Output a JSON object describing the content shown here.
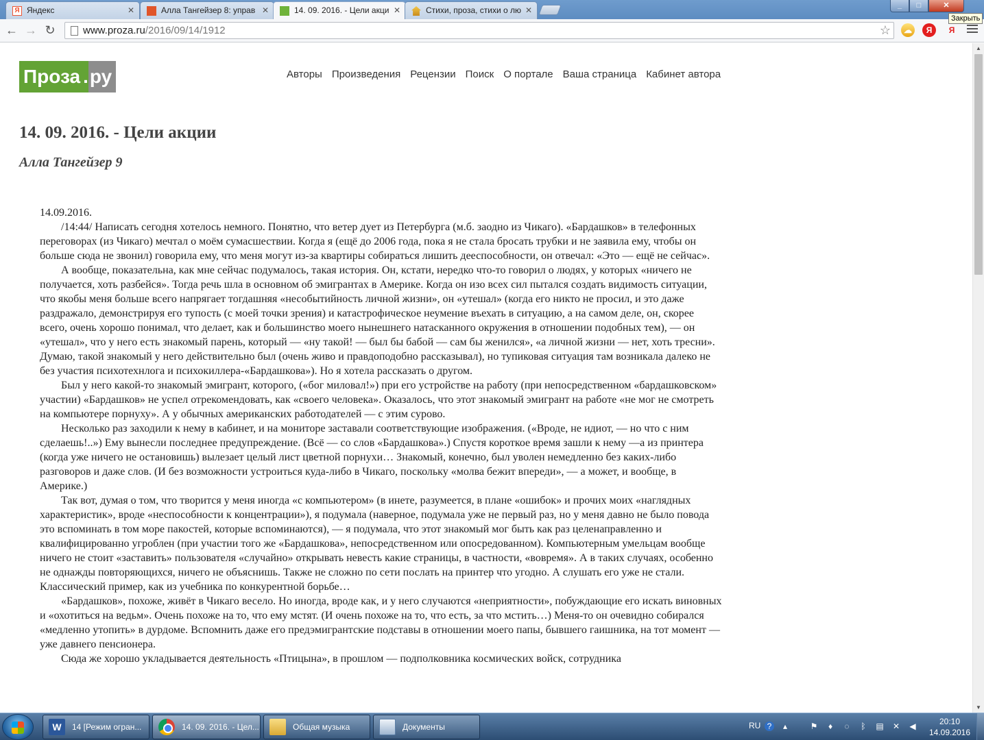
{
  "browser": {
    "tabs": [
      {
        "label": "Яндекс"
      },
      {
        "label": "Алла Тангейзер 8: управ"
      },
      {
        "label": "14. 09. 2016. - Цели акци"
      },
      {
        "label": "Стихи, проза, стихи о лю"
      }
    ],
    "tooltip": "Закрыть",
    "url_host": "www.proza.ru",
    "url_path": "/2016/09/14/1912"
  },
  "site": {
    "logo_main": "Проза",
    "logo_dot": ".",
    "logo_tld": "ру",
    "nav": [
      "Авторы",
      "Произведения",
      "Рецензии",
      "Поиск",
      "О портале",
      "Ваша страница",
      "Кабинет автора"
    ]
  },
  "article": {
    "title": "14. 09. 2016. - Цели акции",
    "author": "Алла Тангейзер 9",
    "date_line": "14.09.2016.",
    "paragraphs": [
      "/14:44/ Написать сегодня хотелось немного. Понятно, что ветер дует из Петербурга (м.б. заодно из Чикаго). «Бардашков» в телефонных переговорах (из Чикаго) мечтал о моём сумасшествии. Когда я (ещё до 2006 года, пока я не стала бросать трубки и не заявила ему, чтобы он больше сюда не звонил) говорила ему, что меня могут из-за квартиры собираться лишить дееспособности, он отвечал: «Это — ещё не сейчас».",
      "А вообще, показательна, как мне сейчас подумалось, такая история. Он, кстати, нередко что-то говорил о людях, у которых «ничего не получается, хоть разбейся». Тогда речь шла в основном об эмигрантах в Америке. Когда он изо всех сил пытался создать видимость ситуации, что якобы меня больше всего напрягает тогдашняя «несобытийность личной жизни», он «утешал» (когда его никто не просил, и это даже раздражало, демонстрируя его тупость (с моей точки зрения) и катастрофическое неумение въехать в ситуацию, а на самом деле, он, скорее всего, очень хорошо понимал, что делает, как и большинство моего нынешнего натасканного окружения в отношении подобных тем), — он «утешал», что у него есть знакомый парень, который — «ну такой! — был бы бабой — сам бы женился», «а личной жизни — нет, хоть тресни». Думаю, такой знакомый у него действительно был (очень живо и правдоподобно рассказывал), но тупиковая ситуация там возникала далеко не без участия психотехнлога и психокиллера-«Бардашкова»). Но я хотела рассказать о другом.",
      "Был у него какой-то знакомый эмигрант, которого, («бог миловал!») при его устройстве на работу (при непосредственном «бардашковском» участии) «Бардашков» не успел отрекомендовать, как «своего человека». Оказалось, что этот знакомый эмигрант на работе «не мог не смотреть на компьютере порнуху». А у обычных американских работодателей — с этим сурово.",
      "Несколько раз заходили к нему в кабинет, и на мониторе заставали соответствующие изображения. («Вроде, не идиот, — но что с ним сделаешь!..») Ему вынесли последнее предупреждение. (Всё — со слов «Бардашкова».) Спустя короткое время зашли к нему —а из принтера (когда уже ничего не остановишь) вылезает целый лист цветной порнухи… Знакомый, конечно, был уволен немедленно без каких-либо разговоров и даже слов. (И без возможности устроиться куда-либо в Чикаго, поскольку «молва бежит впереди», — а может, и вообще, в Америке.)",
      "Так вот, думая о том, что творится у меня иногда «с компьютером» (в инете, разумеется, в плане «ошибок» и прочих моих «наглядных характеристик», вроде «неспособности к концентрации»), я подумала (наверное, подумала уже не первый раз, но у меня давно не было повода это вспоминать в том море пакостей, которые вспоминаются), — я подумала, что этот знакомый мог быть как раз целенаправленно и квалифицированно угроблен (при участии того же «Бардашкова», непосредственном или опосредованном). Компьютерным умельцам вообще ничего не стоит «заставить» пользователя «случайно» открывать невесть какие страницы, в частности, «вовремя». А в таких случаях, особенно не однажды повторяющихся, ничего не объяснишь. Также не сложно по сети послать на принтер что угодно. А слушать его уже не стали. Классический пример, как из учебника по конкурентной борьбе…",
      "«Бардашков», похоже, живёт в Чикаго весело. Но иногда, вроде как, и у него случаются «неприятности», побуждающие его искать виновных и «охотиться на ведьм». Очень похоже на то, что ему мстят. (И очень похоже на то, что есть, за что мстить…) Меня-то он очевидно собирался «медленно утопить» в дурдоме. Вспомнить даже его предэмигрантские подставы в отношении моего папы, бывшего гаишника, на тот момент — уже давнего пенсионера.",
      "Сюда же хорошо укладывается деятельность «Птицына», в прошлом — подполковника космических войск, сотрудника"
    ]
  },
  "taskbar": {
    "items": [
      {
        "label": "14 [Режим огран..."
      },
      {
        "label": "14. 09. 2016. - Цел..."
      },
      {
        "label": "Общая музыка"
      },
      {
        "label": "Документы"
      }
    ],
    "lang": "RU",
    "time": "20:10",
    "date": "14.09.2016"
  }
}
